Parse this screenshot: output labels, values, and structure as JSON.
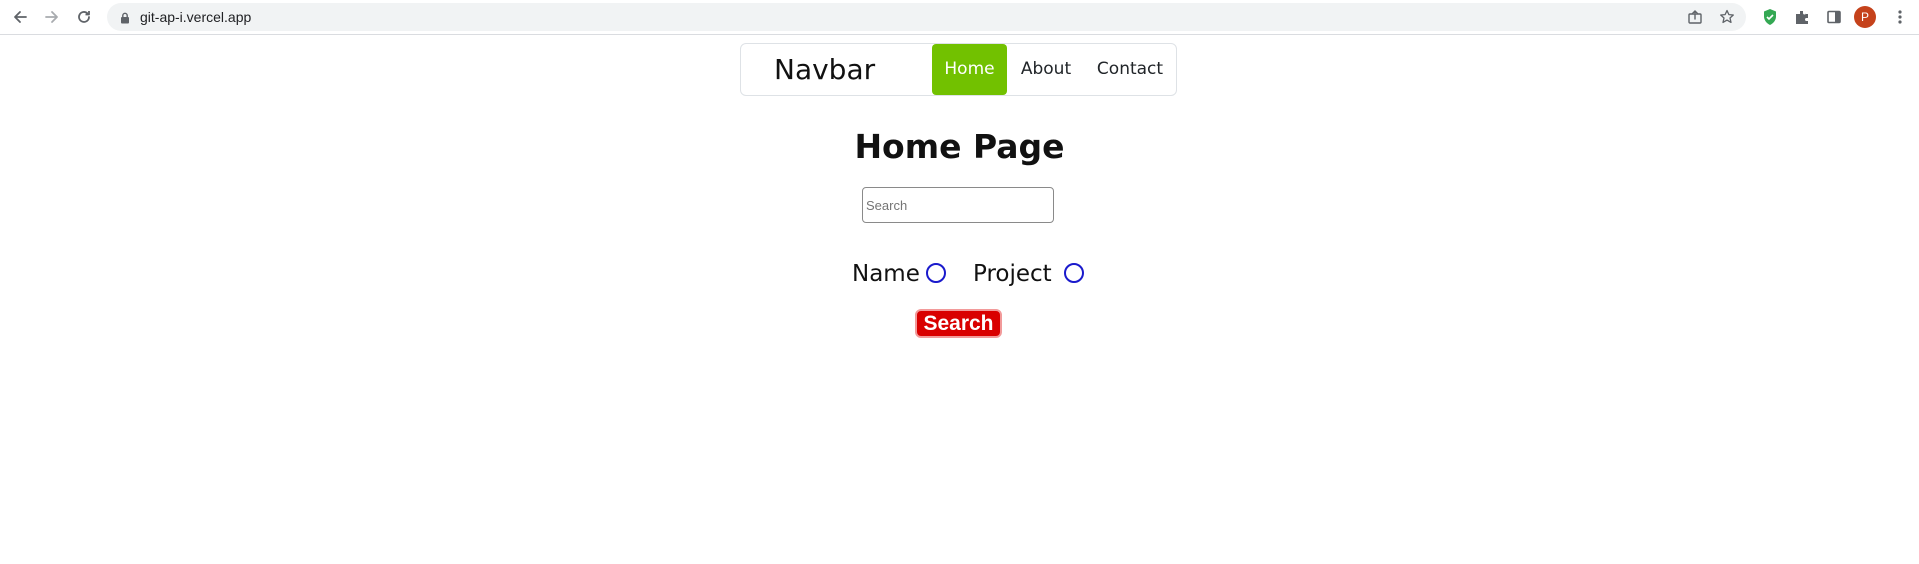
{
  "browser": {
    "url": "git-ap-i.vercel.app",
    "avatar_initial": "P",
    "icons": [
      "back-icon",
      "forward-icon",
      "reload-icon",
      "lock-icon",
      "share-icon",
      "star-icon",
      "shield-extension-icon",
      "extensions-icon",
      "side-panel-icon",
      "menu-icon"
    ],
    "colors": {
      "omnibox_bg": "#f1f3f4",
      "avatar": "#c5421b",
      "extension_shield": "#34a853"
    }
  },
  "navbar": {
    "brand": "Navbar",
    "links": [
      {
        "label": "Home",
        "active": true
      },
      {
        "label": "About",
        "active": false
      },
      {
        "label": "Contact",
        "active": false
      }
    ],
    "active_color": "#72c100"
  },
  "main": {
    "title": "Home Page",
    "search_placeholder": "Search",
    "search_value": "",
    "options": [
      {
        "label": "Name",
        "checked": false
      },
      {
        "label": "Project",
        "checked": false
      }
    ],
    "search_button": "Search",
    "button_color": "#d90000",
    "radio_color": "#1a1acc"
  }
}
